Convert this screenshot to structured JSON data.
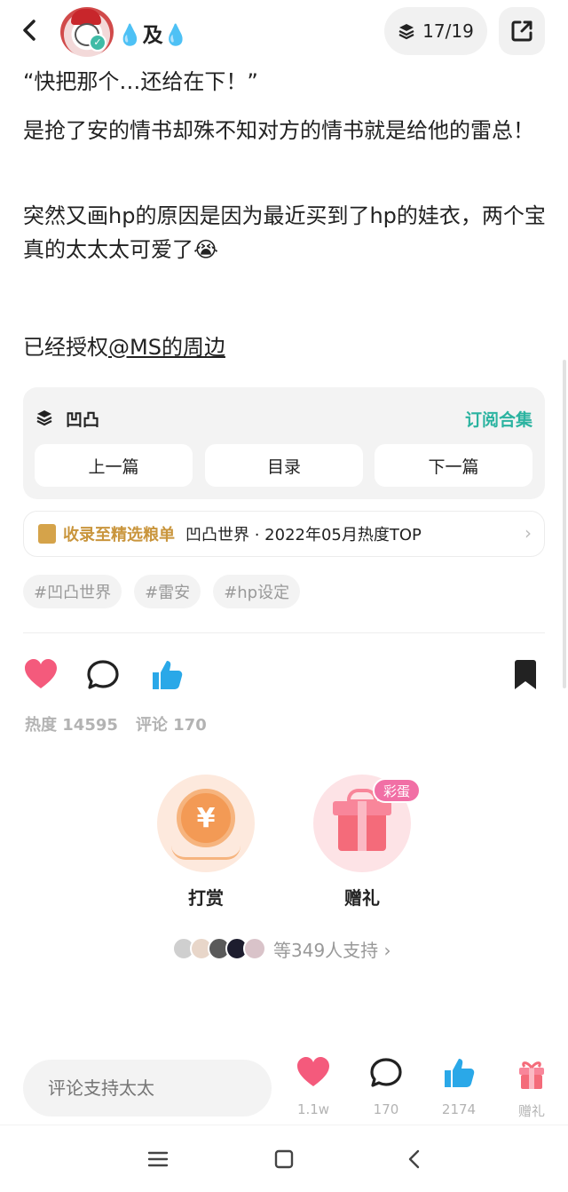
{
  "header": {
    "username_prefix": "💧",
    "username_main": "及",
    "username_suffix": "💧",
    "collection_progress": "17/19"
  },
  "post": {
    "line1": "“快把那个…还给在下！”",
    "line2": "是抢了安的情书却殊不知对方的情书就是给他的雷总！",
    "line3": "突然又画hp的原因是因为最近买到了hp的娃衣，两个宝真的太太太可爱了😭",
    "line4_text": "已经授权",
    "line4_mention": "@MS的周边"
  },
  "collection_card": {
    "title": "凹凸",
    "subscribe": "订阅合集",
    "prev": "上一篇",
    "directory": "目录",
    "next": "下一篇"
  },
  "featured": {
    "label": "收录至精选粮单",
    "text": "凹凸世界 · 2022年05月热度TOP"
  },
  "tags": [
    "#凹凸世界",
    "#雷安",
    "#hp设定"
  ],
  "stats": {
    "heat": "热度 14595",
    "comments": "评论 170"
  },
  "reward": {
    "tip_label": "打赏",
    "gift_label": "赠礼",
    "egg_badge": "彩蛋",
    "coin_symbol": "¥",
    "supporters_text": "等349人支持 ›"
  },
  "bottom_bar": {
    "comment_placeholder": "评论支持太太",
    "likes": "1.1w",
    "comments": "170",
    "thumbs": "2174",
    "gift": "赠礼"
  },
  "colors": {
    "accent_teal": "#2bb3a0",
    "heart_pink": "#f45a7c",
    "thumb_blue": "#2aa8e8",
    "gold": "#c9953c"
  },
  "icons": [
    "back-arrow-icon",
    "collection-stack-icon",
    "share-icon",
    "heart-icon",
    "comment-bubble-icon",
    "thumbs-up-icon",
    "bookmark-icon",
    "gift-icon",
    "coin-icon"
  ]
}
